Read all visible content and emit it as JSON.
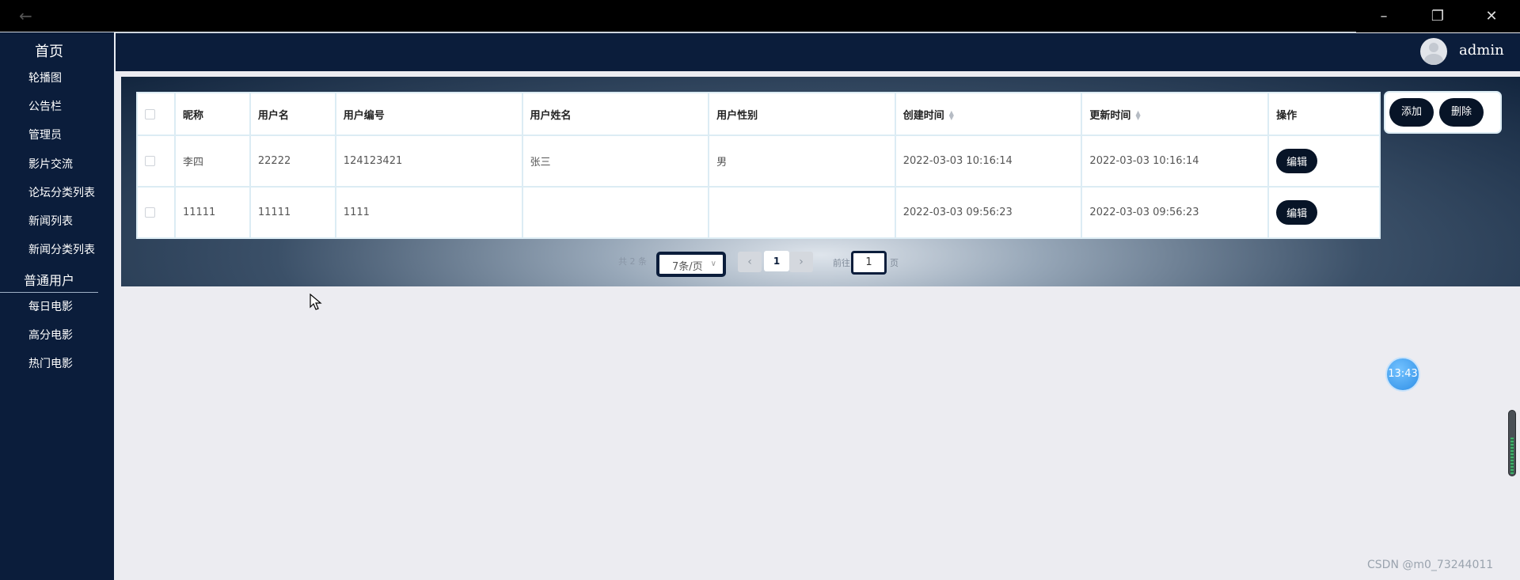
{
  "titlebar": {
    "back_icon": "back-arrow-icon",
    "minimize_icon": "minimize-icon",
    "restore_icon": "restore-icon",
    "close_icon": "close-icon"
  },
  "sidebar": {
    "home": "首页",
    "home_items": [
      "轮播图",
      "公告栏",
      "管理员",
      "影片交流",
      "论坛分类列表",
      "新闻列表",
      "新闻分类列表"
    ],
    "users": "普通用户",
    "users_items": [
      "每日电影",
      "高分电影",
      "热门电影"
    ]
  },
  "header": {
    "username": "admin",
    "avatar_icon": "user-avatar-icon"
  },
  "table": {
    "headers": [
      "昵称",
      "用户名",
      "用户编号",
      "用户姓名",
      "用户性别",
      "创建时间",
      "更新时间",
      "操作"
    ],
    "rows": [
      {
        "nickname": "李四",
        "username": "22222",
        "user_no": "124123421",
        "real_name": "张三",
        "gender": "男",
        "created": "2022-03-03 10:16:14",
        "updated": "2022-03-03 10:16:14",
        "edit": "编辑"
      },
      {
        "nickname": "11111",
        "username": "11111",
        "user_no": "1111",
        "real_name": "",
        "gender": "",
        "created": "2022-03-03 09:56:23",
        "updated": "2022-03-03 09:56:23",
        "edit": "编辑"
      }
    ]
  },
  "actions": {
    "add": "添加",
    "delete": "删除"
  },
  "pagination": {
    "total_text": "共 2 条",
    "page_size": "7条/页",
    "current_page": "1",
    "goto_prefix": "前往",
    "goto_value": "1",
    "goto_suffix": "页"
  },
  "clock": "13:43",
  "watermark": "CSDN @m0_73244011",
  "colors": {
    "navy": "#0b1d3b",
    "button_dark": "#071427",
    "table_border": "#dcecf4",
    "page_bg": "#ececf1"
  }
}
